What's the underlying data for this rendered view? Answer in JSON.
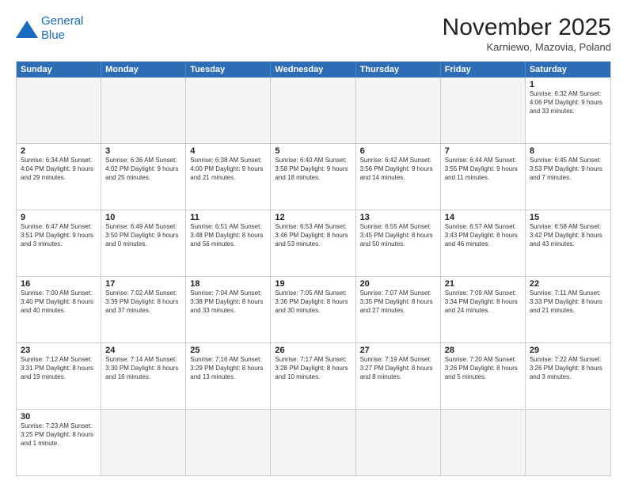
{
  "header": {
    "logo_line1": "General",
    "logo_line2": "Blue",
    "title": "November 2025",
    "subtitle": "Karniewo, Mazovia, Poland"
  },
  "days": [
    "Sunday",
    "Monday",
    "Tuesday",
    "Wednesday",
    "Thursday",
    "Friday",
    "Saturday"
  ],
  "weeks": [
    [
      {
        "day": "",
        "empty": true
      },
      {
        "day": "",
        "empty": true
      },
      {
        "day": "",
        "empty": true
      },
      {
        "day": "",
        "empty": true
      },
      {
        "day": "",
        "empty": true
      },
      {
        "day": "",
        "empty": true
      },
      {
        "day": "1",
        "info": "Sunrise: 6:32 AM\nSunset: 4:06 PM\nDaylight: 9 hours\nand 33 minutes."
      }
    ],
    [
      {
        "day": "2",
        "info": "Sunrise: 6:34 AM\nSunset: 4:04 PM\nDaylight: 9 hours\nand 29 minutes."
      },
      {
        "day": "3",
        "info": "Sunrise: 6:36 AM\nSunset: 4:02 PM\nDaylight: 9 hours\nand 25 minutes."
      },
      {
        "day": "4",
        "info": "Sunrise: 6:38 AM\nSunset: 4:00 PM\nDaylight: 9 hours\nand 21 minutes."
      },
      {
        "day": "5",
        "info": "Sunrise: 6:40 AM\nSunset: 3:58 PM\nDaylight: 9 hours\nand 18 minutes."
      },
      {
        "day": "6",
        "info": "Sunrise: 6:42 AM\nSunset: 3:56 PM\nDaylight: 9 hours\nand 14 minutes."
      },
      {
        "day": "7",
        "info": "Sunrise: 6:44 AM\nSunset: 3:55 PM\nDaylight: 9 hours\nand 11 minutes."
      },
      {
        "day": "8",
        "info": "Sunrise: 6:45 AM\nSunset: 3:53 PM\nDaylight: 9 hours\nand 7 minutes."
      }
    ],
    [
      {
        "day": "9",
        "info": "Sunrise: 6:47 AM\nSunset: 3:51 PM\nDaylight: 9 hours\nand 3 minutes."
      },
      {
        "day": "10",
        "info": "Sunrise: 6:49 AM\nSunset: 3:50 PM\nDaylight: 9 hours\nand 0 minutes."
      },
      {
        "day": "11",
        "info": "Sunrise: 6:51 AM\nSunset: 3:48 PM\nDaylight: 8 hours\nand 56 minutes."
      },
      {
        "day": "12",
        "info": "Sunrise: 6:53 AM\nSunset: 3:46 PM\nDaylight: 8 hours\nand 53 minutes."
      },
      {
        "day": "13",
        "info": "Sunrise: 6:55 AM\nSunset: 3:45 PM\nDaylight: 8 hours\nand 50 minutes."
      },
      {
        "day": "14",
        "info": "Sunrise: 6:57 AM\nSunset: 3:43 PM\nDaylight: 8 hours\nand 46 minutes."
      },
      {
        "day": "15",
        "info": "Sunrise: 6:58 AM\nSunset: 3:42 PM\nDaylight: 8 hours\nand 43 minutes."
      }
    ],
    [
      {
        "day": "16",
        "info": "Sunrise: 7:00 AM\nSunset: 3:40 PM\nDaylight: 8 hours\nand 40 minutes."
      },
      {
        "day": "17",
        "info": "Sunrise: 7:02 AM\nSunset: 3:39 PM\nDaylight: 8 hours\nand 37 minutes."
      },
      {
        "day": "18",
        "info": "Sunrise: 7:04 AM\nSunset: 3:38 PM\nDaylight: 8 hours\nand 33 minutes."
      },
      {
        "day": "19",
        "info": "Sunrise: 7:05 AM\nSunset: 3:36 PM\nDaylight: 8 hours\nand 30 minutes."
      },
      {
        "day": "20",
        "info": "Sunrise: 7:07 AM\nSunset: 3:35 PM\nDaylight: 8 hours\nand 27 minutes."
      },
      {
        "day": "21",
        "info": "Sunrise: 7:09 AM\nSunset: 3:34 PM\nDaylight: 8 hours\nand 24 minutes."
      },
      {
        "day": "22",
        "info": "Sunrise: 7:11 AM\nSunset: 3:33 PM\nDaylight: 8 hours\nand 21 minutes."
      }
    ],
    [
      {
        "day": "23",
        "info": "Sunrise: 7:12 AM\nSunset: 3:31 PM\nDaylight: 8 hours\nand 19 minutes."
      },
      {
        "day": "24",
        "info": "Sunrise: 7:14 AM\nSunset: 3:30 PM\nDaylight: 8 hours\nand 16 minutes."
      },
      {
        "day": "25",
        "info": "Sunrise: 7:16 AM\nSunset: 3:29 PM\nDaylight: 8 hours\nand 13 minutes."
      },
      {
        "day": "26",
        "info": "Sunrise: 7:17 AM\nSunset: 3:28 PM\nDaylight: 8 hours\nand 10 minutes."
      },
      {
        "day": "27",
        "info": "Sunrise: 7:19 AM\nSunset: 3:27 PM\nDaylight: 8 hours\nand 8 minutes."
      },
      {
        "day": "28",
        "info": "Sunrise: 7:20 AM\nSunset: 3:26 PM\nDaylight: 8 hours\nand 5 minutes."
      },
      {
        "day": "29",
        "info": "Sunrise: 7:22 AM\nSunset: 3:26 PM\nDaylight: 8 hours\nand 3 minutes."
      }
    ],
    [
      {
        "day": "30",
        "info": "Sunrise: 7:23 AM\nSunset: 3:25 PM\nDaylight: 8 hours\nand 1 minute."
      },
      {
        "day": "",
        "empty": true
      },
      {
        "day": "",
        "empty": true
      },
      {
        "day": "",
        "empty": true
      },
      {
        "day": "",
        "empty": true
      },
      {
        "day": "",
        "empty": true
      },
      {
        "day": "",
        "empty": true
      }
    ]
  ]
}
